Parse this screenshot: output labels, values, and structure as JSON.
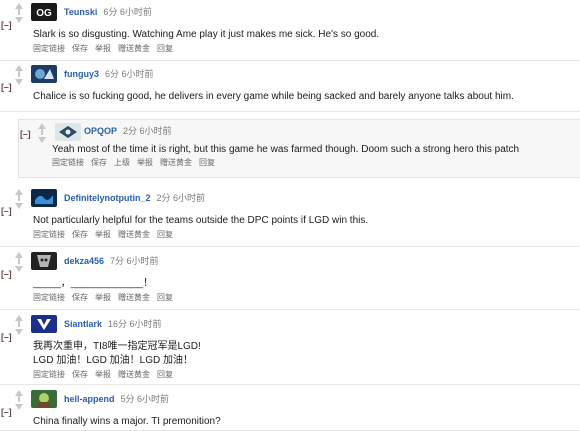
{
  "colors": {
    "author": "#2a5db0",
    "time": "#7a7a7a",
    "arrow": "#c8c8c8",
    "collapse": "#6a4a4a",
    "nested_bg": "#f7f7f8"
  },
  "comments": [
    {
      "collapse": "[–]",
      "avatar_icon": "og-logo-icon",
      "author": "Teunski",
      "time": "6分 6小时前",
      "body_lines": [
        "Slark is so disgusting. Watching Ame play it just makes me sick. He's so good."
      ],
      "actions": [
        "固定链接",
        "保存",
        "举报",
        "赠送黄金",
        "回复"
      ]
    },
    {
      "collapse": "[–]",
      "avatar_icon": "team-avatar-icon",
      "author": "funguy3",
      "time": "6分 6小时前",
      "body_lines": [
        "Chalice is so fucking good, he delivers in every game while being sacked and barely anyone talks about him."
      ],
      "actions": []
    },
    {
      "collapse": "[–]",
      "avatar_icon": "eg-logo-icon",
      "author": "OPQOP",
      "time": "2分 6小时前",
      "body_lines": [
        "Yeah most of the time it is right, but this game he was farmed though. Doom such a strong hero this patch"
      ],
      "actions": [
        "固定链接",
        "保存",
        "上级",
        "举报",
        "赠送黄金",
        "回复"
      ]
    },
    {
      "collapse": "[–]",
      "avatar_icon": "liquid-logo-icon",
      "author": "Definitelynotputin_2",
      "time": "2分 6小时前",
      "body_lines": [
        "Not particularly helpful for the teams outside the DPC points if LGD win this."
      ],
      "actions": [
        "固定链接",
        "保存",
        "举报",
        "赠送黄金",
        "回复"
      ]
    },
    {
      "collapse": "[–]",
      "avatar_icon": "secret-logo-icon",
      "author": "dekza456",
      "time": "7分 6小时前",
      "body_lines": [
        "_____，_____________！"
      ],
      "actions": [
        "固定链接",
        "保存",
        "举报",
        "赠送黄金",
        "回复"
      ]
    },
    {
      "collapse": "[–]",
      "avatar_icon": "vici-logo-icon",
      "author": "Siantlark",
      "time": "16分 6小时前",
      "body_lines": [
        "我再次重申，TI8唯一指定冠军是LGD!",
        "LGD 加油！LGD 加油！LGD 加油！"
      ],
      "actions": [
        "固定链接",
        "保存",
        "举报",
        "赠送黄金",
        "回复"
      ]
    },
    {
      "collapse": "[–]",
      "avatar_icon": "hero-avatar-icon",
      "author": "hell-append",
      "time": "5分 6小时前",
      "body_lines": [
        "China finally wins a major. TI premonition?"
      ],
      "actions": []
    }
  ]
}
